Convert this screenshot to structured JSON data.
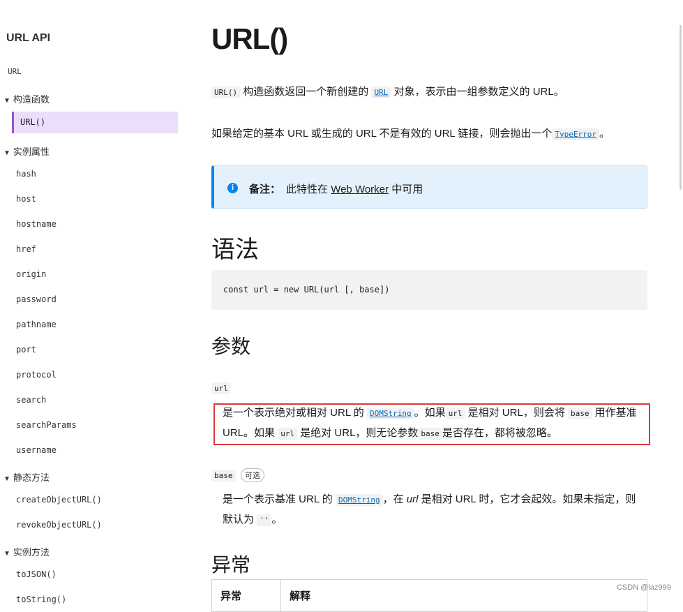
{
  "sidebar": {
    "title": "URL API",
    "top_item": "URL",
    "sections": [
      {
        "label": "构造函数",
        "items": [
          "URL()"
        ]
      },
      {
        "label": "实例属性",
        "items": [
          "hash",
          "host",
          "hostname",
          "href",
          "origin",
          "password",
          "pathname",
          "port",
          "protocol",
          "search",
          "searchParams",
          "username"
        ]
      },
      {
        "label": "静态方法",
        "items": [
          "createObjectURL()",
          "revokeObjectURL()"
        ]
      },
      {
        "label": "实例方法",
        "items": [
          "toJSON()",
          "toString()"
        ]
      }
    ]
  },
  "main": {
    "title": "URL()",
    "intro": {
      "code": "URL()",
      "text1": "构造函数返回一个新创建的",
      "link": "URL",
      "text2": "对象，表示由一组参数定义的 URL。"
    },
    "error_para": {
      "text": "如果给定的基本 URL 或生成的 URL 不是有效的 URL 链接，则会抛出一个",
      "link": "TypeError",
      "end": "。"
    },
    "note": {
      "icon": "info-icon",
      "label": "备注：",
      "text1": "此特性在",
      "link": "Web Worker",
      "text2": "中可用"
    },
    "syntax_heading": "语法",
    "syntax_code": "const url = new URL(url [, base])",
    "params_heading": "参数",
    "param_url": {
      "term": "url",
      "t1": "是一个表示绝对或相对 URL 的",
      "link": "DOMString",
      "t2": "。如果",
      "c1": "url",
      "t3": "是相对 URL，则会将",
      "c2": "base",
      "t4": "用作基准 URL。如果",
      "c3": "url",
      "t5": "是绝对 URL，则无论参数",
      "c4": "base",
      "t6": "是否存在，都将被忽略。"
    },
    "param_base": {
      "term": "base",
      "badge": "可选",
      "t1": "是一个表示基准 URL 的",
      "link": "DOMString",
      "t2": "，在",
      "em": "url",
      "t3": "是相对 URL 时，它才会起效。如果未指定，则默认为",
      "c1": "''",
      "t4": "。"
    },
    "exceptions_heading": "异常",
    "table_headers": [
      "异常",
      "解释"
    ]
  },
  "watermark": "CSDN @iaz999"
}
